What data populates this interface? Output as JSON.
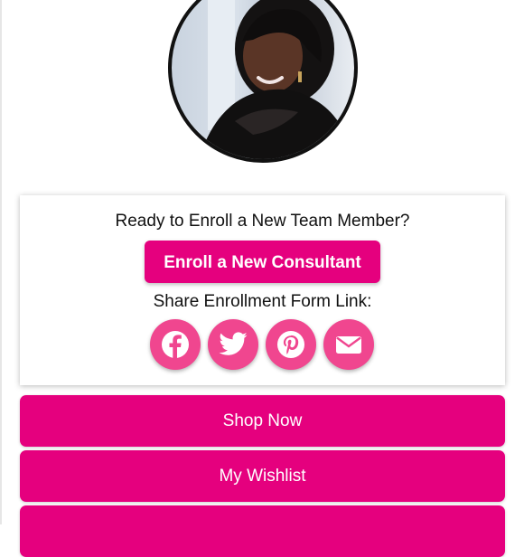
{
  "enroll": {
    "title": "Ready to Enroll a New Team Member?",
    "button_label": "Enroll a New Consultant",
    "share_label": "Share Enrollment Form Link:"
  },
  "share_icons": [
    "facebook-icon",
    "twitter-icon",
    "pinterest-icon",
    "email-icon"
  ],
  "menu": {
    "shop_now": "Shop Now",
    "my_wishlist": "My Wishlist"
  },
  "colors": {
    "brand_pink": "#e5007e",
    "share_pink": "#f0468f"
  }
}
